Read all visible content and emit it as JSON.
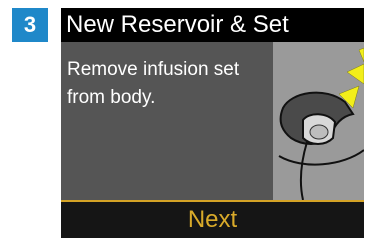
{
  "step": {
    "number": "3"
  },
  "screen": {
    "title": "New Reservoir & Set",
    "instruction": "Remove infusion set from body.",
    "illustration_icon": "infusion-set-removal-icon",
    "next_label": "Next"
  },
  "colors": {
    "step_badge": "#1f88c9",
    "title_bar": "#000000",
    "content_bg": "#555555",
    "illustration_bg": "#9a9a9a",
    "arrows": "#f2ee1a",
    "next_text": "#d9aa2a",
    "divider": "#d4a326"
  }
}
